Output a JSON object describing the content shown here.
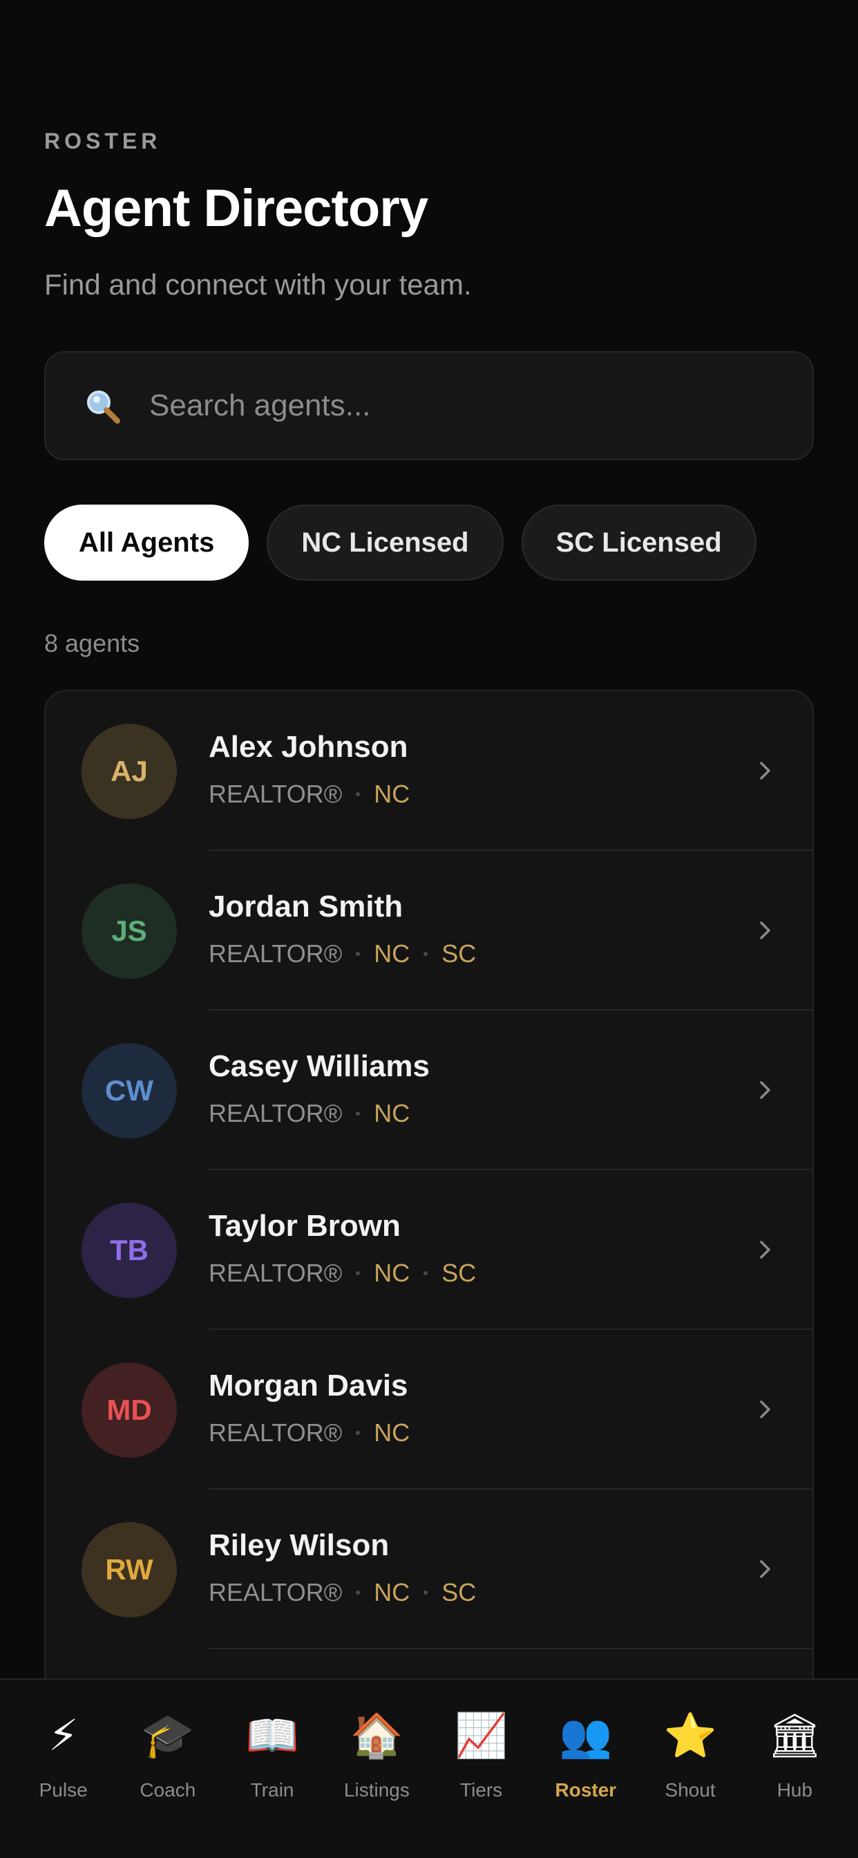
{
  "header": {
    "eyebrow": "ROSTER",
    "title": "Agent Directory",
    "subtitle": "Find and connect with your team."
  },
  "search": {
    "placeholder": "Search agents...",
    "icon": "search-icon"
  },
  "filters": [
    {
      "label": "All Agents",
      "active": true
    },
    {
      "label": "NC Licensed",
      "active": false
    },
    {
      "label": "SC Licensed",
      "active": false
    }
  ],
  "count_label": "8 agents",
  "colors": {
    "accent": "#d4a94f",
    "license": "#c9a45c"
  },
  "agents": [
    {
      "initials": "AJ",
      "name": "Alex Johnson",
      "role": "REALTOR®",
      "licenses": [
        "NC"
      ],
      "avatar_bg": "#3b3322",
      "avatar_fg": "#d9b36a"
    },
    {
      "initials": "JS",
      "name": "Jordan Smith",
      "role": "REALTOR®",
      "licenses": [
        "NC",
        "SC"
      ],
      "avatar_bg": "#1e2e24",
      "avatar_fg": "#5fae7a"
    },
    {
      "initials": "CW",
      "name": "Casey Williams",
      "role": "REALTOR®",
      "licenses": [
        "NC"
      ],
      "avatar_bg": "#1e2a3d",
      "avatar_fg": "#5d8fd0"
    },
    {
      "initials": "TB",
      "name": "Taylor Brown",
      "role": "REALTOR®",
      "licenses": [
        "NC",
        "SC"
      ],
      "avatar_bg": "#2c2346",
      "avatar_fg": "#8f6ee6"
    },
    {
      "initials": "MD",
      "name": "Morgan Davis",
      "role": "REALTOR®",
      "licenses": [
        "NC"
      ],
      "avatar_bg": "#432021",
      "avatar_fg": "#e85252"
    },
    {
      "initials": "RW",
      "name": "Riley Wilson",
      "role": "REALTOR®",
      "licenses": [
        "NC",
        "SC"
      ],
      "avatar_bg": "#3d3120",
      "avatar_fg": "#e0aa3c"
    }
  ],
  "tabs": [
    {
      "label": "Pulse",
      "icon": "⚡",
      "icon_name": "lightning-icon",
      "active": false
    },
    {
      "label": "Coach",
      "icon": "🎓",
      "icon_name": "graduation-cap-icon",
      "active": false
    },
    {
      "label": "Train",
      "icon": "📖",
      "icon_name": "open-book-icon",
      "active": false
    },
    {
      "label": "Listings",
      "icon": "🏠",
      "icon_name": "house-icon",
      "active": false
    },
    {
      "label": "Tiers",
      "icon": "📈",
      "icon_name": "chart-increasing-icon",
      "active": false
    },
    {
      "label": "Roster",
      "icon": "👥",
      "icon_name": "people-icon",
      "active": true
    },
    {
      "label": "Shout",
      "icon": "⭐",
      "icon_name": "star-icon",
      "active": false
    },
    {
      "label": "Hub",
      "icon": "🏛",
      "icon_name": "classical-building-icon",
      "active": false
    }
  ]
}
